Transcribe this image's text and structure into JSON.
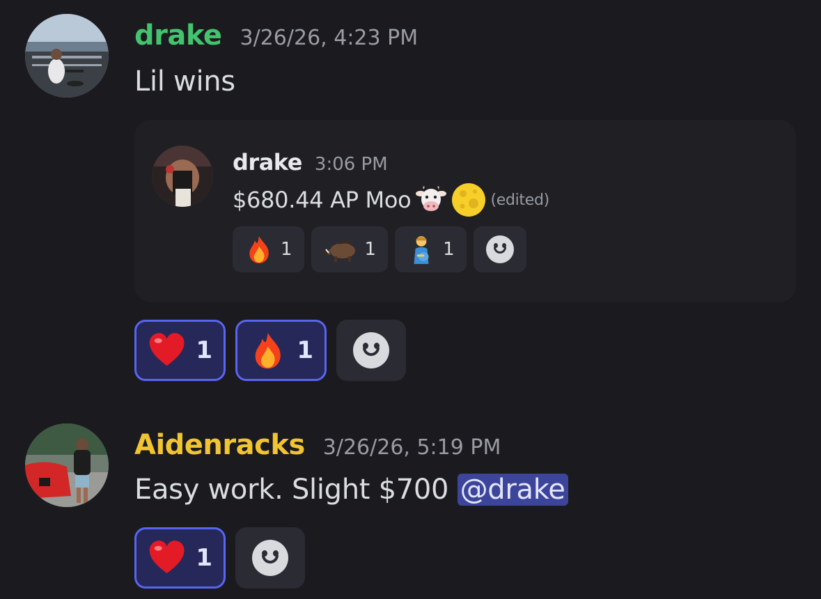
{
  "messages": [
    {
      "username": "drake",
      "username_color": "#43c36e",
      "timestamp": "3/26/26, 4:23 PM",
      "text": "Lil wins",
      "forwarded": {
        "username": "drake",
        "timestamp": "3:06 PM",
        "text": "$680.44 AP Moo",
        "inline_emojis": [
          "cow-face-emoji",
          "full-moon-emoji"
        ],
        "edited_label": "(edited)",
        "reactions": [
          {
            "emoji": "fire-emoji",
            "count": "1"
          },
          {
            "emoji": "boar-emoji",
            "count": "1"
          },
          {
            "emoji": "pregnant-man-emoji",
            "count": "1"
          }
        ]
      },
      "reactions": [
        {
          "emoji": "red-heart-emoji",
          "count": "1",
          "selected": true
        },
        {
          "emoji": "fire-emoji",
          "count": "1",
          "selected": true
        }
      ]
    },
    {
      "username": "Aidenracks",
      "username_color": "#f0c432",
      "timestamp": "3/26/26, 5:19 PM",
      "text": "Easy work. Slight $700 ",
      "mention": "@drake",
      "reactions": [
        {
          "emoji": "red-heart-emoji",
          "count": "1",
          "selected": true
        }
      ]
    }
  ],
  "add_reaction_icon": "smile-face-icon",
  "colors": {
    "background": "#1b1b1f",
    "mention_bg": "#3c4599",
    "reaction_selected_border": "#5865f2"
  }
}
